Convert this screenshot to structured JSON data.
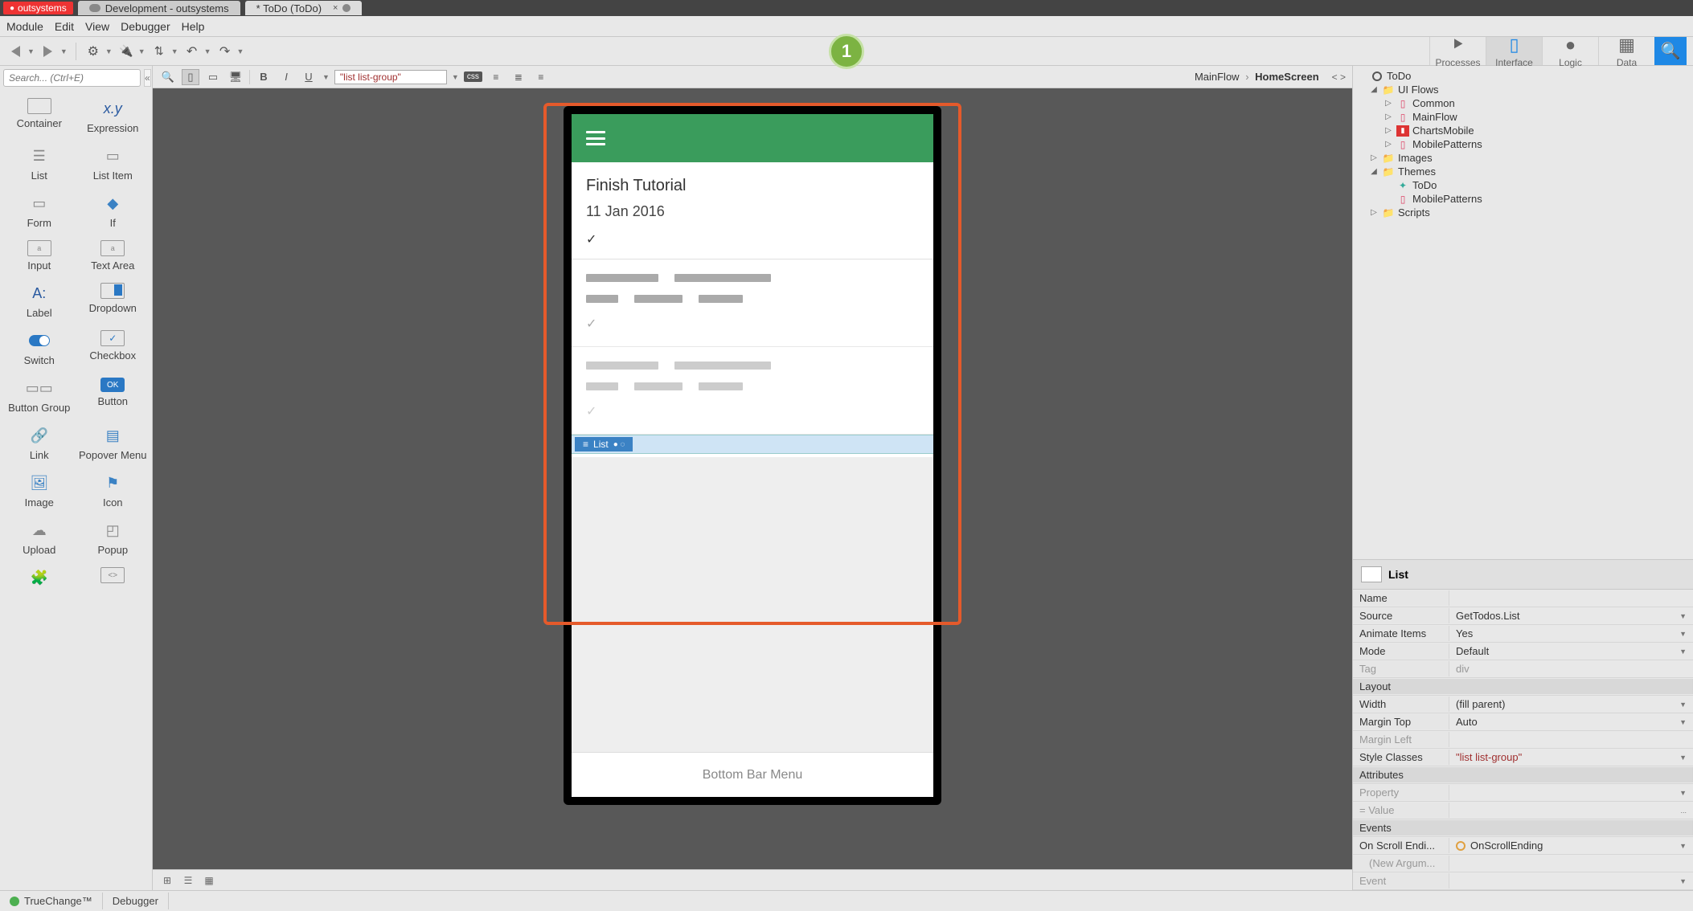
{
  "titlebar": {
    "brand": "outsystems",
    "tab1": "Development - outsystems",
    "tab2": "* ToDo (ToDo)"
  },
  "menu": {
    "module": "Module",
    "edit": "Edit",
    "view": "View",
    "debugger": "Debugger",
    "help": "Help"
  },
  "step_number": "1",
  "topnav": {
    "processes": "Processes",
    "interface": "Interface",
    "logic": "Logic",
    "data": "Data"
  },
  "toolbox": {
    "search_placeholder": "Search... (Ctrl+E)",
    "items": [
      {
        "label": "Container"
      },
      {
        "label": "Expression",
        "glyph": "x.y"
      },
      {
        "label": "List"
      },
      {
        "label": "List Item"
      },
      {
        "label": "Form"
      },
      {
        "label": "If"
      },
      {
        "label": "Input"
      },
      {
        "label": "Text Area"
      },
      {
        "label": "Label",
        "glyph": "A:"
      },
      {
        "label": "Dropdown"
      },
      {
        "label": "Switch"
      },
      {
        "label": "Checkbox"
      },
      {
        "label": "Button Group"
      },
      {
        "label": "Button",
        "glyph": "OK"
      },
      {
        "label": "Link"
      },
      {
        "label": "Popover Menu"
      },
      {
        "label": "Image"
      },
      {
        "label": "Icon"
      },
      {
        "label": "Upload"
      },
      {
        "label": "Popup"
      }
    ]
  },
  "canvas_toolbar": {
    "style_value": "\"list list-group\"",
    "css_badge": "css"
  },
  "breadcrumb": {
    "flow": "MainFlow",
    "screen": "HomeScreen",
    "caret": "›",
    "code": "< >"
  },
  "phone": {
    "todo_title": "Finish Tutorial",
    "todo_date": "11 Jan 2016",
    "checkmark": "✓",
    "list_tag": "List",
    "bottom_bar": "Bottom Bar Menu"
  },
  "tree": {
    "root": "ToDo",
    "uiflows": "UI Flows",
    "common": "Common",
    "mainflow": "MainFlow",
    "charts": "ChartsMobile",
    "mobilepatterns": "MobilePatterns",
    "images": "Images",
    "themes": "Themes",
    "theme_todo": "ToDo",
    "theme_patterns": "MobilePatterns",
    "scripts": "Scripts"
  },
  "props": {
    "title": "List",
    "rows": {
      "name_k": "Name",
      "name_v": "",
      "source_k": "Source",
      "source_v": "GetTodos.List",
      "animate_k": "Animate Items",
      "animate_v": "Yes",
      "mode_k": "Mode",
      "mode_v": "Default",
      "tag_k": "Tag",
      "tag_v": "div",
      "layout_k": "Layout",
      "width_k": "Width",
      "width_v": "(fill parent)",
      "mtop_k": "Margin Top",
      "mtop_v": "Auto",
      "mleft_k": "Margin Left",
      "mleft_v": "",
      "styles_k": "Style Classes",
      "styles_v": "\"list list-group\"",
      "attrs_k": "Attributes",
      "prop_k": "Property",
      "prop_v": "",
      "val_k": "= Value",
      "val_v": "...",
      "events_k": "Events",
      "scroll_k": "On Scroll Endi...",
      "scroll_v": "OnScrollEnding",
      "newarg_k": "(New Argum...",
      "newarg_v": "",
      "event_k": "Event",
      "event_v": ""
    }
  },
  "status": {
    "truechange": "TrueChange™",
    "debugger": "Debugger"
  }
}
